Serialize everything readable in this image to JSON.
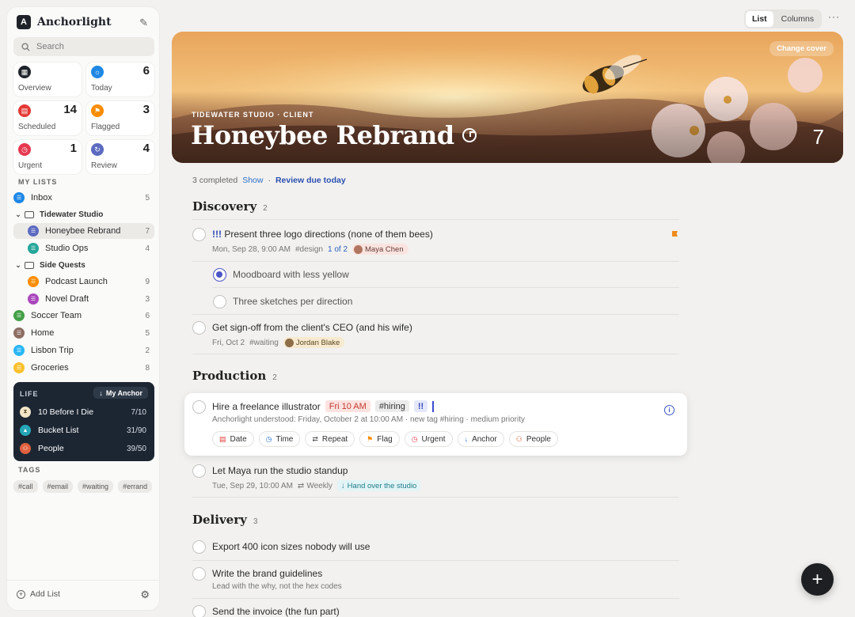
{
  "app": {
    "name": "Anchorlight"
  },
  "search": {
    "placeholder": "Search"
  },
  "smart_lists": [
    {
      "label": "Overview",
      "count": "",
      "color": "#1f2329",
      "icon": "grid-icon"
    },
    {
      "label": "Today",
      "count": "6",
      "color": "#1e88e5",
      "icon": "sun-icon"
    },
    {
      "label": "Scheduled",
      "count": "14",
      "color": "#e53935",
      "icon": "calendar-icon"
    },
    {
      "label": "Flagged",
      "count": "3",
      "color": "#fb8c00",
      "icon": "flag-icon"
    },
    {
      "label": "Urgent",
      "count": "1",
      "color": "#e53950",
      "icon": "alarm-icon"
    },
    {
      "label": "Review",
      "count": "4",
      "color": "#5c6bc0",
      "icon": "refresh-icon"
    }
  ],
  "my_lists_header": "MY LISTS",
  "lists": {
    "inbox": {
      "label": "Inbox",
      "count": "5",
      "color": "#1e88e5"
    },
    "tidewater": {
      "label": "Tidewater Studio"
    },
    "honeybee": {
      "label": "Honeybee Rebrand",
      "count": "7",
      "color": "#5c6bc0"
    },
    "studio_ops": {
      "label": "Studio Ops",
      "count": "4",
      "color": "#26a69a"
    },
    "side_quests": {
      "label": "Side Quests"
    },
    "podcast": {
      "label": "Podcast Launch",
      "count": "9",
      "color": "#fb8c00"
    },
    "novel": {
      "label": "Novel Draft",
      "count": "3",
      "color": "#ab47bc"
    },
    "soccer": {
      "label": "Soccer Team",
      "count": "6",
      "color": "#43a047"
    },
    "home": {
      "label": "Home",
      "count": "5",
      "color": "#8d6e63"
    },
    "lisbon": {
      "label": "Lisbon Trip",
      "count": "2",
      "color": "#29b6f6"
    },
    "groceries": {
      "label": "Groceries",
      "count": "8",
      "color": "#fbc02d"
    }
  },
  "life": {
    "header": "LIFE",
    "anchor_label": "My Anchor",
    "rows": [
      {
        "label": "10 Before I Die",
        "count": "7/10",
        "color": "#f1e5c8",
        "icon": "hourglass-icon"
      },
      {
        "label": "Bucket List",
        "count": "31/90",
        "color": "#26a6b8",
        "icon": "mountain-icon"
      },
      {
        "label": "People",
        "count": "39/50",
        "color": "#e0613f",
        "icon": "people-icon"
      }
    ]
  },
  "tags_header": "TAGS",
  "tags": [
    "#call",
    "#email",
    "#waiting",
    "#errand"
  ],
  "footer": {
    "add_list": "Add List"
  },
  "view": {
    "list": "List",
    "columns": "Columns"
  },
  "banner": {
    "change_cover": "Change cover",
    "subtitle": "TIDEWATER STUDIO · CLIENT",
    "title": "Honeybee Rebrand",
    "count": "7"
  },
  "status": {
    "completed": "3 completed",
    "show": "Show",
    "sep": "·",
    "review": "Review due today"
  },
  "sections": {
    "discovery": {
      "title": "Discovery",
      "count": "2"
    },
    "production": {
      "title": "Production",
      "count": "2"
    },
    "delivery": {
      "title": "Delivery",
      "count": "3"
    }
  },
  "tasks": {
    "t1": {
      "priority": "!!!",
      "title": "Present three logo directions (none of them bees)",
      "date": "Mon, Sep 28, 9:00 AM",
      "tag": "#design",
      "subs": "1 of 2",
      "person": "Maya Chen"
    },
    "s1": {
      "title": "Moodboard with less yellow"
    },
    "s2": {
      "title": "Three sketches per direction"
    },
    "t2": {
      "title": "Get sign-off from the client's CEO (and his wife)",
      "date": "Fri, Oct 2",
      "tag": "#waiting",
      "person": "Jordan Blake"
    },
    "t3": {
      "title": "Hire a freelance illustrator",
      "date_pill": "Fri 10 AM",
      "tag_pill": "#hiring",
      "pri_pill": "!!",
      "understood": "Anchorlight understood: Friday, October 2 at 10:00 AM · new tag #hiring · medium priority"
    },
    "t4": {
      "title": "Let Maya run the studio standup",
      "date": "Tue, Sep 29, 10:00 AM",
      "repeat": "Weekly",
      "anchor": "Hand over the studio"
    },
    "t5": {
      "title": "Export 400 icon sizes nobody will use"
    },
    "t6": {
      "title": "Write the brand guidelines",
      "note": "Lead with the why, not the hex codes"
    },
    "t7": {
      "title": "Send the invoice (the fun part)"
    }
  },
  "actions": [
    "Date",
    "Time",
    "Repeat",
    "Flag",
    "Urgent",
    "Anchor",
    "People"
  ]
}
